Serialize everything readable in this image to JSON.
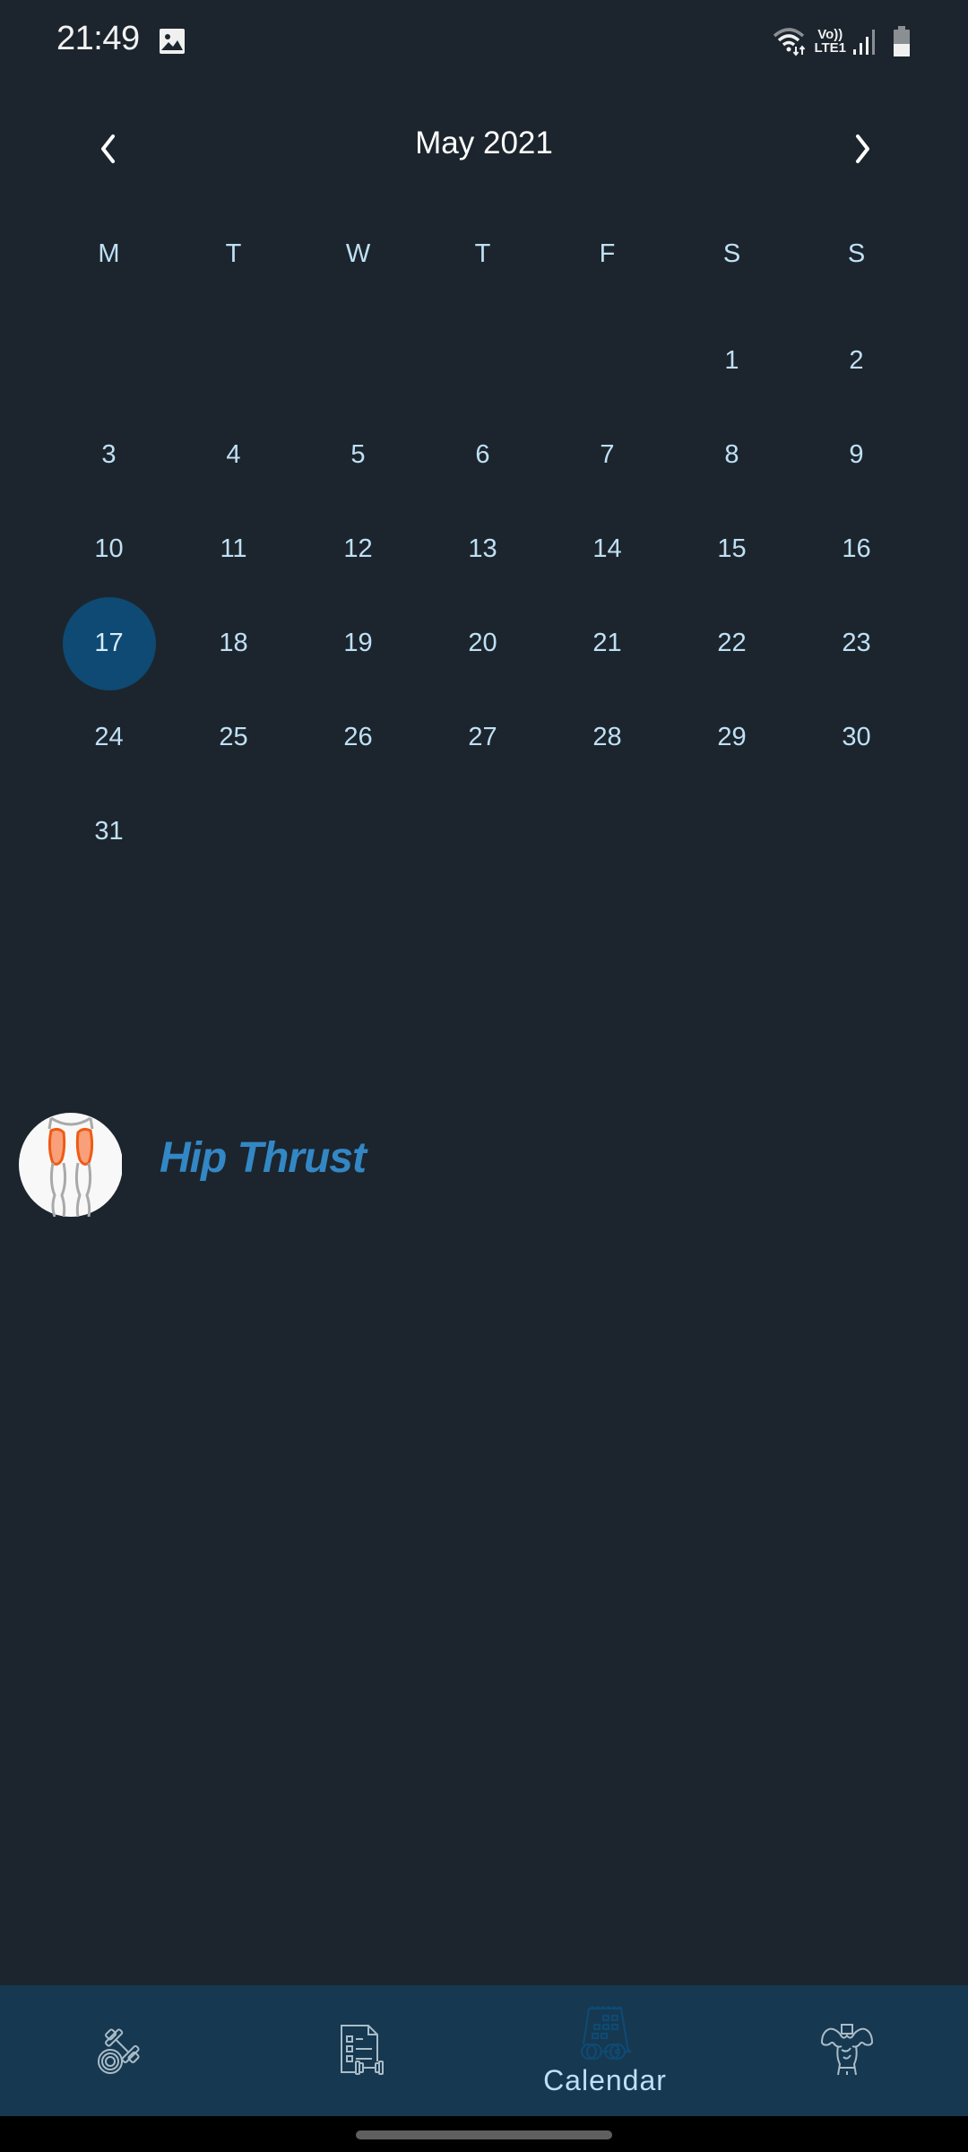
{
  "status_bar": {
    "time": "21:49",
    "network_label_top": "Vo))",
    "network_label_bottom": "LTE1",
    "icons": [
      "gallery-icon",
      "wifi-icon",
      "signal-icon",
      "battery-icon"
    ]
  },
  "calendar": {
    "month_title": "May 2021",
    "prev_icon": "chevron-left-icon",
    "next_icon": "chevron-right-icon",
    "weekdays": [
      "M",
      "T",
      "W",
      "T",
      "F",
      "S",
      "S"
    ],
    "weeks": [
      [
        "",
        "",
        "",
        "",
        "",
        "1",
        "2"
      ],
      [
        "3",
        "4",
        "5",
        "6",
        "7",
        "8",
        "9"
      ],
      [
        "10",
        "11",
        "12",
        "13",
        "14",
        "15",
        "16"
      ],
      [
        "17",
        "18",
        "19",
        "20",
        "21",
        "22",
        "23"
      ],
      [
        "24",
        "25",
        "26",
        "27",
        "28",
        "29",
        "30"
      ],
      [
        "31",
        "",
        "",
        "",
        "",
        "",
        ""
      ]
    ],
    "selected_day": "17",
    "selected_color": "#0e4a73"
  },
  "exercise": {
    "name": "Hip Thrust",
    "thumbnail_icon": "glutes-muscle-icon",
    "name_color": "#3387c5"
  },
  "bottom_nav": {
    "items": [
      {
        "icon": "dumbbell-plate-icon",
        "label": "",
        "active": false
      },
      {
        "icon": "workout-plan-icon",
        "label": "",
        "active": false
      },
      {
        "icon": "calendar-workout-icon",
        "label": "Calendar",
        "active": true
      },
      {
        "icon": "bodybuilder-icon",
        "label": "",
        "active": false
      }
    ],
    "background": "#163850",
    "active_icon_color": "#0e4a73"
  }
}
